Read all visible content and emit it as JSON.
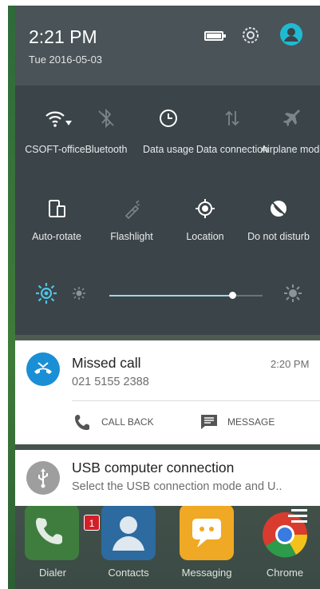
{
  "status": {
    "time": "2:21 PM",
    "date": "Tue 2016-05-03",
    "icons": [
      "battery-icon",
      "settings-icon",
      "user-icon"
    ]
  },
  "quick_settings": {
    "tiles": [
      {
        "label": "CSOFT-office",
        "icon": "wifi-icon",
        "active": true
      },
      {
        "label": "Bluetooth",
        "icon": "bluetooth-off-icon",
        "active": false
      },
      {
        "label": "Data usage",
        "icon": "data-usage-icon",
        "active": true
      },
      {
        "label": "Data connection",
        "icon": "data-connection-icon",
        "active": false
      },
      {
        "label": "Airplane mode",
        "icon": "airplane-icon",
        "active": false
      },
      {
        "label": "Auto-rotate",
        "icon": "auto-rotate-icon",
        "active": true
      },
      {
        "label": "Flashlight",
        "icon": "flashlight-icon",
        "active": false
      },
      {
        "label": "Location",
        "icon": "location-icon",
        "active": true
      },
      {
        "label": "Do not disturb",
        "icon": "do-not-disturb-icon",
        "active": true
      }
    ],
    "brightness": {
      "level": 0.8,
      "icons": [
        "auto-brightness-icon",
        "brightness-low-icon",
        "brightness-high-icon"
      ]
    }
  },
  "notifications": {
    "missed_call": {
      "title": "Missed call",
      "number": "021 5155 2388",
      "time": "2:20 PM",
      "icon": "missed-call-icon",
      "accent": "#1a8fd6",
      "actions": [
        {
          "label": "CALL BACK",
          "icon": "phone-icon"
        },
        {
          "label": "MESSAGE",
          "icon": "message-icon"
        }
      ]
    },
    "usb": {
      "title": "USB computer connection",
      "text": "Select the USB connection mode and U..",
      "icon": "usb-icon",
      "accent": "#9e9e9e"
    }
  },
  "dock": {
    "apps": [
      {
        "label": "Dialer",
        "icon": "dialer-icon",
        "badge": "1"
      },
      {
        "label": "Contacts",
        "icon": "contacts-icon"
      },
      {
        "label": "Messaging",
        "icon": "messaging-icon"
      },
      {
        "label": "Chrome",
        "icon": "chrome-icon"
      }
    ]
  }
}
